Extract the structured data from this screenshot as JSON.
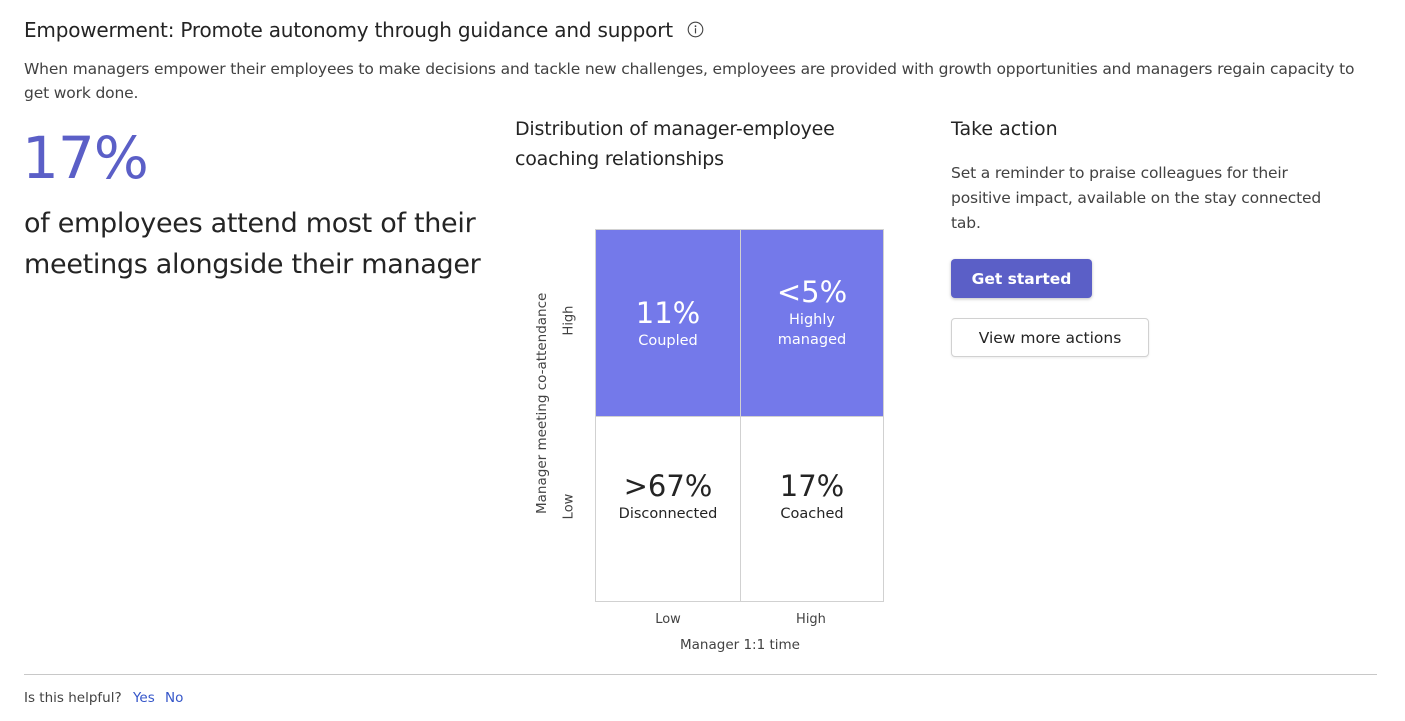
{
  "header": {
    "title": "Empowerment: Promote autonomy through guidance and support",
    "info_icon": "info-icon",
    "description": "When managers empower their employees to make decisions and tackle new challenges, employees are provided with growth opportunities and managers regain capacity to get work done."
  },
  "stat": {
    "value": "17%",
    "description": "of employees attend most of their meetings alongside their manager"
  },
  "matrix": {
    "title": "Distribution of manager-employee coaching relationships",
    "y_axis_label": "Manager meeting co-attendance",
    "x_axis_label": "Manager 1:1 time",
    "y_ticks": {
      "high": "High",
      "low": "Low"
    },
    "x_ticks": {
      "low": "Low",
      "high": "High"
    },
    "cells": {
      "top_left": {
        "value": "11%",
        "label": "Coupled"
      },
      "top_right": {
        "value": "<5%",
        "label": "Highly managed"
      },
      "bottom_left": {
        "value": ">67%",
        "label": "Disconnected"
      },
      "bottom_right": {
        "value": "17%",
        "label": "Coached"
      }
    },
    "colors": {
      "high_fill": "#7479ea",
      "low_fill": "#ffffff"
    }
  },
  "action": {
    "title": "Take action",
    "description": "Set a reminder to praise colleagues for their positive impact, available on the stay connected tab.",
    "primary_button": "Get started",
    "secondary_button": "View more actions"
  },
  "feedback": {
    "question": "Is this helpful?",
    "yes": "Yes",
    "no": "No"
  },
  "colors": {
    "accent": "#5b5fc7",
    "link": "#3556c9"
  }
}
